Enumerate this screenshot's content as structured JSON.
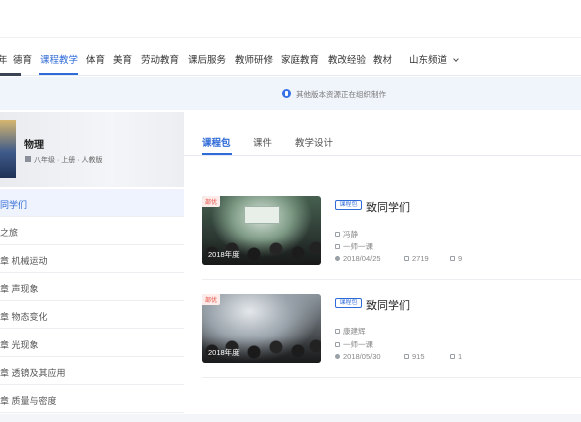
{
  "nav": {
    "items": [
      {
        "label": "年"
      },
      {
        "label": "德育"
      },
      {
        "label": "课程教学"
      },
      {
        "label": "体育"
      },
      {
        "label": "美育"
      },
      {
        "label": "劳动教育"
      },
      {
        "label": "课后服务"
      },
      {
        "label": "教师研修"
      },
      {
        "label": "家庭教育"
      },
      {
        "label": "教改经验"
      },
      {
        "label": "教材"
      },
      {
        "label": "山东频道"
      }
    ],
    "active_index": 2,
    "dropdown_icon": "chevron-down-icon"
  },
  "notice": {
    "text": "其他版本资源正在组织制作",
    "icon": "info-icon",
    "accent": "#3572e6"
  },
  "book": {
    "title": "物理",
    "subtitle": "八年级 · 上册 · 人教版"
  },
  "chapters": [
    {
      "label": "同学们"
    },
    {
      "label": "之旅"
    },
    {
      "label": "章   机械运动"
    },
    {
      "label": "章   声现象"
    },
    {
      "label": "章   物态变化"
    },
    {
      "label": "章   光现象"
    },
    {
      "label": "章   透镜及其应用"
    },
    {
      "label": "章   质量与密度"
    }
  ],
  "tabs": [
    {
      "label": "课程包"
    },
    {
      "label": "课件"
    },
    {
      "label": "教学设计"
    }
  ],
  "items": [
    {
      "badge": "部优",
      "year": "2018年度",
      "pkg": "课程包",
      "title": "致同学们",
      "author": "冯静",
      "type": "一师一课",
      "date": "2018/04/25",
      "views": "2719",
      "likes": "9"
    },
    {
      "badge": "部优",
      "year": "2018年度",
      "pkg": "课程包",
      "title": "致同学们",
      "author": "康建辉",
      "type": "一师一课",
      "date": "2018/05/30",
      "views": "915",
      "likes": "1"
    }
  ],
  "colors": {
    "accent": "#2f6bd8",
    "badge_red": "#e2483b"
  }
}
